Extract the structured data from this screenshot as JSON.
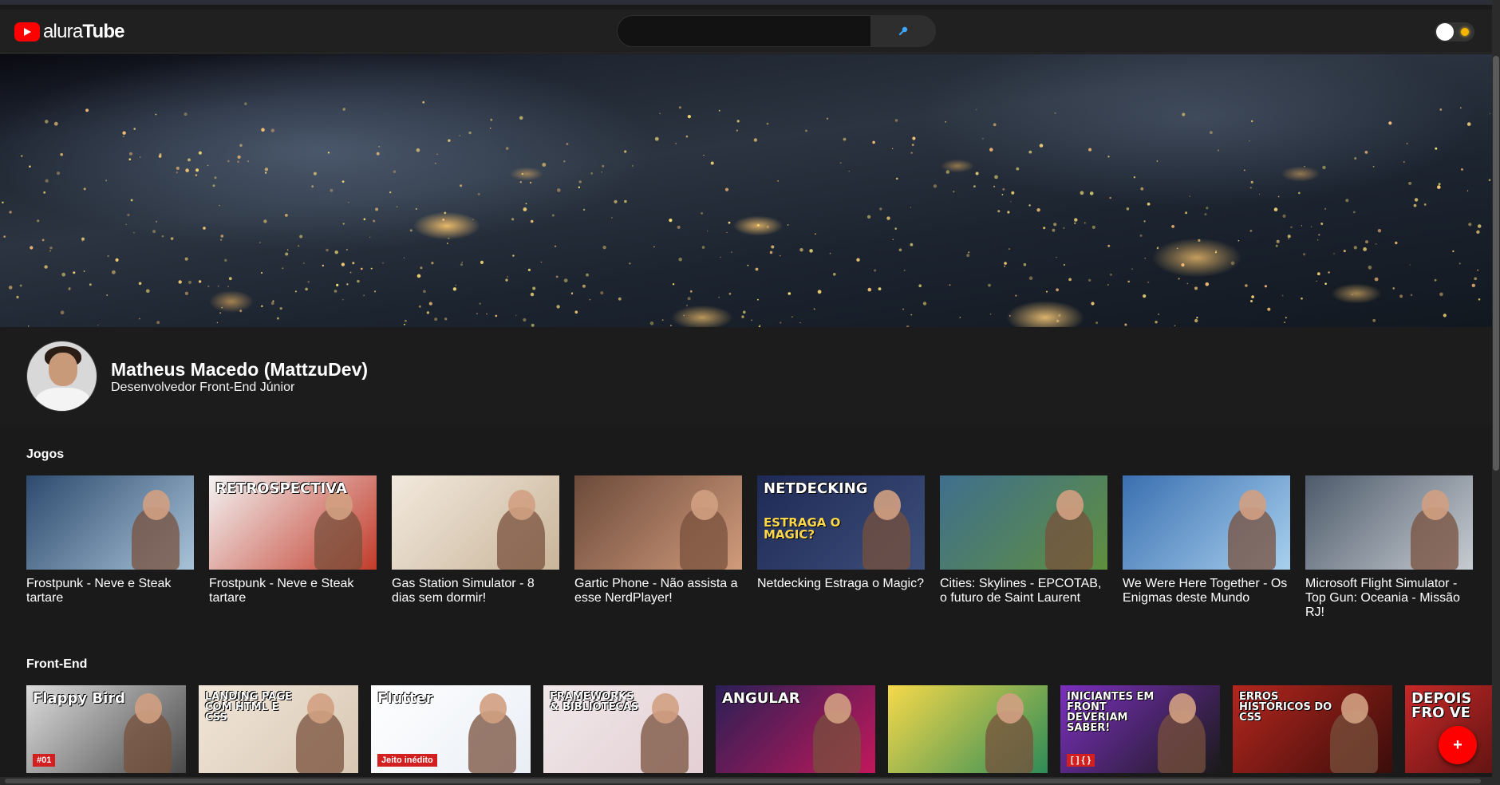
{
  "header": {
    "logo_text_light": "alura",
    "logo_text_bold": "Tube",
    "search": {
      "placeholder": "",
      "value": ""
    },
    "search_icon": "search-icon",
    "theme_toggle": {
      "state": "dark"
    }
  },
  "profile": {
    "name": "Matheus Macedo (MattzuDev)",
    "role": "Desenvolvedor Front-End Júnior"
  },
  "sections": [
    {
      "title": "Jogos",
      "videos": [
        {
          "title": "Frostpunk - Neve e Steak tartare",
          "thumb_text": "",
          "bg1": "#2d4a6e",
          "bg2": "#a9c3d8"
        },
        {
          "title": "Frostpunk - Neve e Steak tartare",
          "thumb_text": "RETROSPECTIVA",
          "bg1": "#f3f3f3",
          "bg2": "#c23b2a"
        },
        {
          "title": "Gas Station Simulator - 8 dias sem dormir!",
          "thumb_text": "",
          "bg1": "#f2e9dd",
          "bg2": "#c9b59a"
        },
        {
          "title": "Gartic Phone - Não assista a esse NerdPlayer!",
          "thumb_text": "",
          "bg1": "#6b4a3a",
          "bg2": "#d19b7c"
        },
        {
          "title": "Netdecking Estraga o Magic?",
          "thumb_text": "NETDECKING",
          "thumb_text2": "ESTRAGA O MAGIC?",
          "bg1": "#1e2a55",
          "bg2": "#3d4f7a"
        },
        {
          "title": "Cities: Skylines - EPCOTAB, o futuro de Saint Laurent",
          "thumb_text": "",
          "bg1": "#3f6f8e",
          "bg2": "#5f8f3e"
        },
        {
          "title": "We Were Here Together - Os Enigmas deste Mundo",
          "thumb_text": "",
          "bg1": "#3a6fb0",
          "bg2": "#a8d0ee"
        },
        {
          "title": "Microsoft Flight Simulator - Top Gun: Oceania - Missão RJ!",
          "thumb_text": "",
          "bg1": "#4d5a6a",
          "bg2": "#c7ccd2"
        }
      ]
    },
    {
      "title": "Front-End",
      "videos": [
        {
          "thumb_text": "Flappy Bird",
          "badge": "#01",
          "bg1": "#dcdcdc",
          "bg2": "#4a4a4a"
        },
        {
          "thumb_text": "LANDING PAGE COM HTML E CSS",
          "bg1": "#f1e6d8",
          "bg2": "#d8c7b3"
        },
        {
          "thumb_text": "Flutter",
          "badge": "Jeito inédito",
          "bg1": "#ffffff",
          "bg2": "#e9eef5"
        },
        {
          "thumb_text": "FRAMEWORKS & BIBLIOTECAS",
          "bg1": "#f0e8ea",
          "bg2": "#e3cfd4"
        },
        {
          "thumb_text": "ANGULAR",
          "bg1": "#2a1f55",
          "bg2": "#c2185b"
        },
        {
          "thumb_text": "",
          "bg1": "#f6d94a",
          "bg2": "#2e8b57"
        },
        {
          "thumb_text": "INICIANTES EM FRONT DEVERIAM SABER!",
          "badge": "[ ] { }",
          "bg1": "#7b2fbe",
          "bg2": "#1a1a1a"
        },
        {
          "thumb_text": "ERROS HISTÓRICOS DO CSS",
          "bg1": "#b3261e",
          "bg2": "#3a0d0a"
        },
        {
          "thumb_text": "DEPOIS FRO VE",
          "bg1": "#c62828",
          "bg2": "#3a0d0a"
        }
      ]
    }
  ],
  "fab": {
    "label": "+"
  }
}
